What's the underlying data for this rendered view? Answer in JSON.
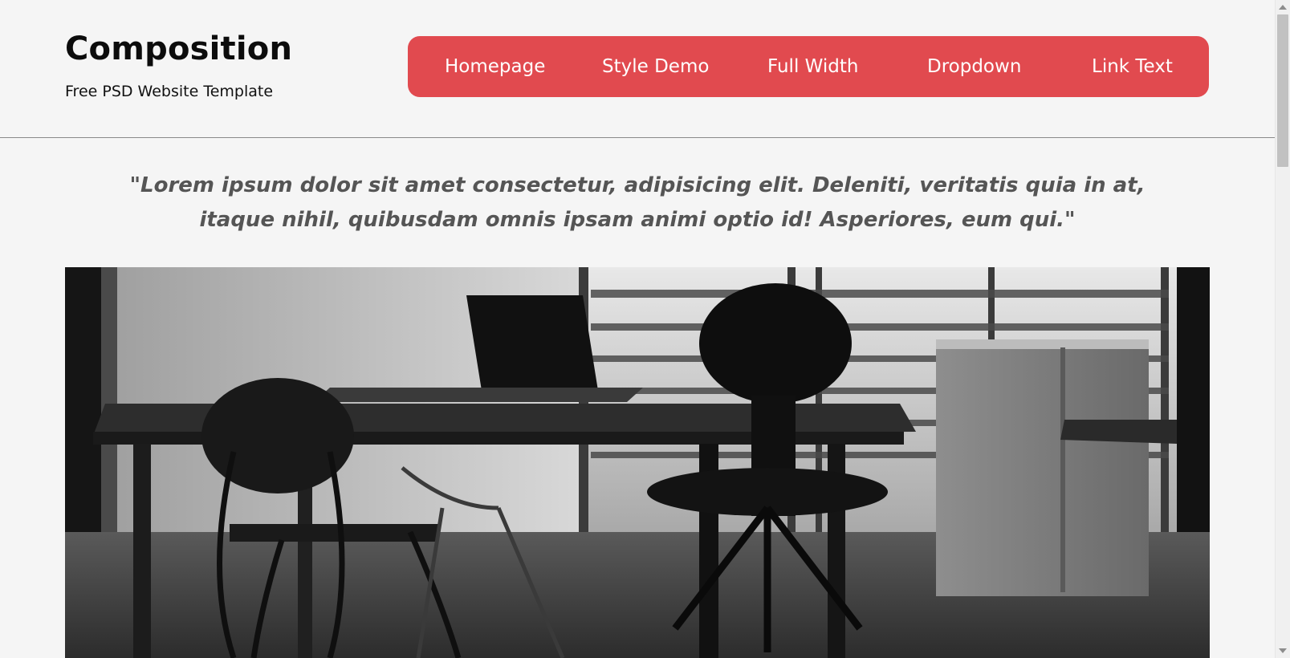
{
  "brand": {
    "title": "Composition",
    "subtitle": "Free PSD Website Template"
  },
  "nav": {
    "background_color": "#e14a4f",
    "items": [
      {
        "label": "Homepage"
      },
      {
        "label": "Style Demo"
      },
      {
        "label": "Full Width"
      },
      {
        "label": "Dropdown"
      },
      {
        "label": "Link Text"
      }
    ]
  },
  "quote": {
    "line1": "\"Lorem ipsum dolor sit amet consectetur, adipisicing elit. Deleniti, veritatis quia in at,",
    "line2": "itaque nihil, quibusdam omnis ipsam animi optio id! Asperiores, eum qui.\""
  },
  "hero": {
    "image_subject": "office-desk-chairs-photo",
    "tone": "black-and-white"
  }
}
